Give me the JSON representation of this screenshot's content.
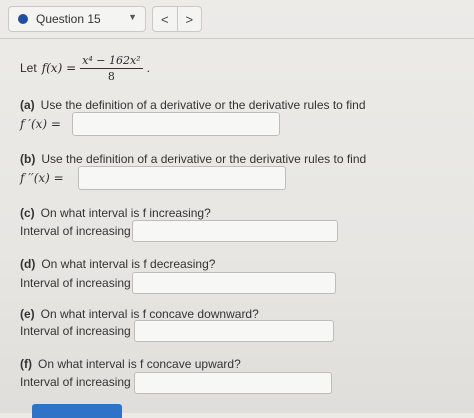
{
  "header": {
    "question_label": "Question 15",
    "prev_glyph": "<",
    "next_glyph": ">"
  },
  "problem": {
    "let_text": "Let",
    "func_lhs": "f(x) =",
    "numerator": "x⁴ − 162x²",
    "denominator": "8",
    "end_punct": "."
  },
  "parts": {
    "a": {
      "label": "(a)",
      "text": "Use the definition of a derivative or the derivative rules to find",
      "answer_label": "f ′(x) ="
    },
    "b": {
      "label": "(b)",
      "text": "Use the definition of a derivative or the derivative rules to find",
      "answer_label": "f ′′(x) ="
    },
    "c": {
      "label": "(c)",
      "text": "On what interval is f increasing?",
      "answer_label": "Interval of increasing ="
    },
    "d": {
      "label": "(d)",
      "text": "On what interval is f decreasing?",
      "answer_label": "Interval of increasing ="
    },
    "e": {
      "label": "(e)",
      "text": "On what interval is f concave downward?",
      "answer_label": "Interval of increasing ="
    },
    "f": {
      "label": "(f)",
      "text": "On what interval is f concave upward?",
      "answer_label": "Interval of increasing ="
    }
  },
  "colors": {
    "accent": "#1f4fa0",
    "button": "#2f73c9"
  }
}
